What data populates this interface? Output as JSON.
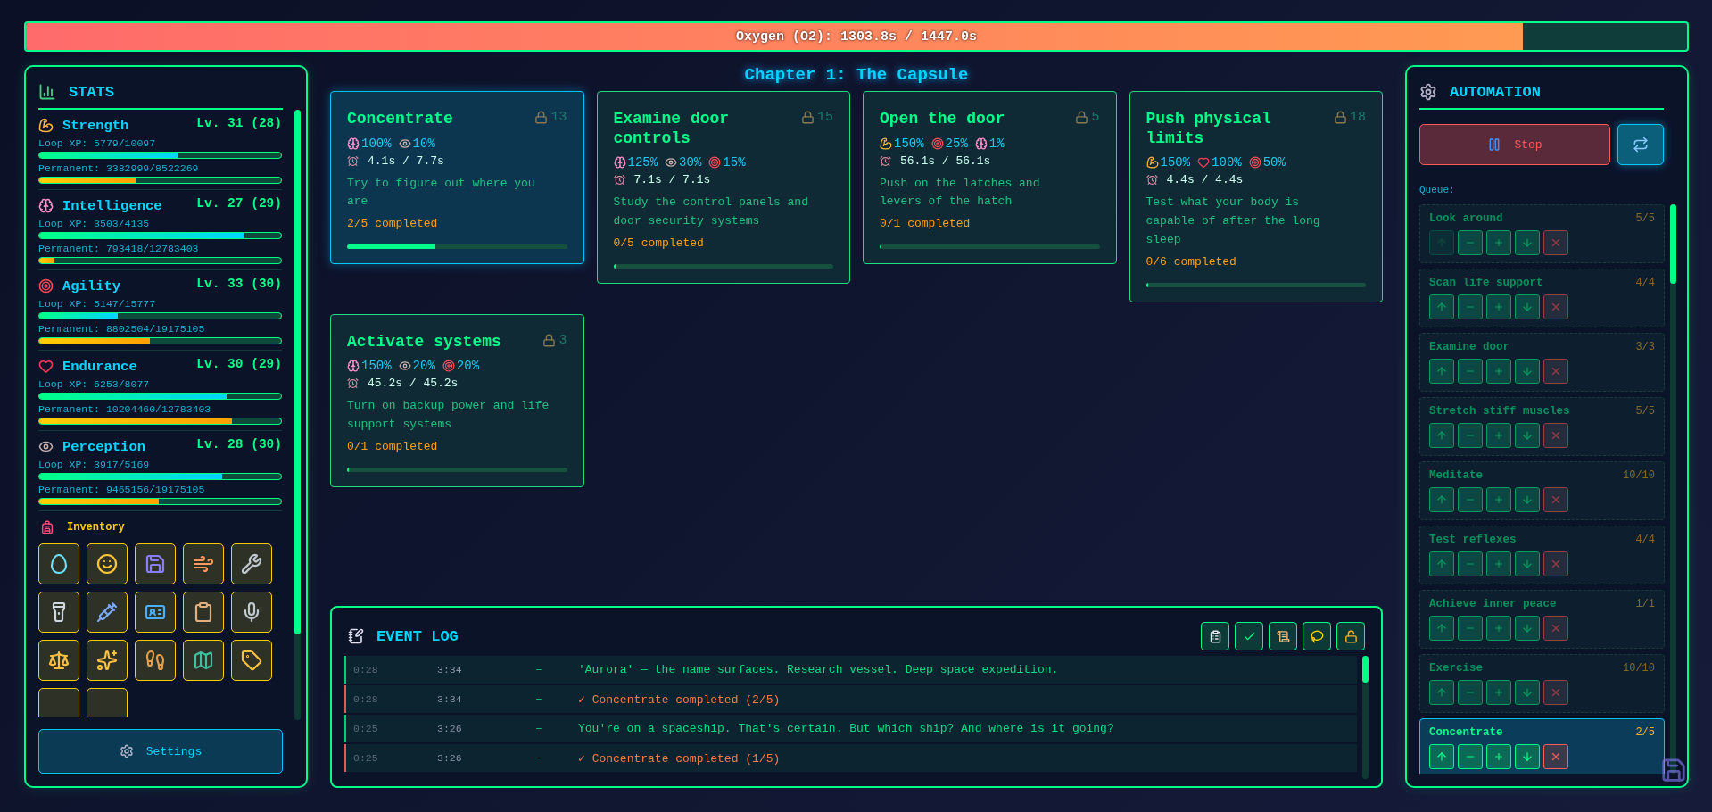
{
  "oxygen": {
    "label": "Oxygen (O2): 1303.8s / 1447.0s",
    "level": 0.901
  },
  "stats": {
    "title": "STATS",
    "items": [
      {
        "kind": "strength",
        "name": "Strength",
        "level_text": "Lv. 31 (28)",
        "loop": {
          "label": "Loop XP: 5779/10097",
          "level": 0.572
        },
        "permanent": {
          "label": "Permanent: 3382999/8522269",
          "level": 0.397
        }
      },
      {
        "kind": "intelligence",
        "name": "Intelligence",
        "level_text": "Lv. 27 (29)",
        "loop": {
          "label": "Loop XP: 3503/4135",
          "level": 0.847
        },
        "permanent": {
          "label": "Permanent: 793418/12783403",
          "level": 0.062
        }
      },
      {
        "kind": "agility",
        "name": "Agility",
        "level_text": "Lv. 33 (30)",
        "loop": {
          "label": "Loop XP: 5147/15777",
          "level": 0.326
        },
        "permanent": {
          "label": "Permanent: 8802504/19175105",
          "level": 0.459
        }
      },
      {
        "kind": "endurance",
        "name": "Endurance",
        "level_text": "Lv. 30 (29)",
        "loop": {
          "label": "Loop XP: 6253/8077",
          "level": 0.774
        },
        "permanent": {
          "label": "Permanent: 10204460/12783403",
          "level": 0.798
        }
      },
      {
        "kind": "perception",
        "name": "Perception",
        "level_text": "Lv. 28 (30)",
        "loop": {
          "label": "Loop XP: 3917/5169",
          "level": 0.758
        },
        "permanent": {
          "label": "Permanent: 9465156/19175105",
          "level": 0.494
        }
      }
    ]
  },
  "inventory": {
    "title": "Inventory",
    "items": [
      {
        "kind": "mirror"
      },
      {
        "kind": "mask"
      },
      {
        "kind": "floppy"
      },
      {
        "kind": "beads"
      },
      {
        "kind": "wrench"
      },
      {
        "kind": "flashlight"
      },
      {
        "kind": "syringe"
      },
      {
        "kind": "id_card"
      },
      {
        "kind": "clipboard"
      },
      {
        "kind": "microphone"
      },
      {
        "kind": "scale"
      },
      {
        "kind": "sparkles"
      },
      {
        "kind": "boot"
      },
      {
        "kind": "map"
      },
      {
        "kind": "tag"
      },
      {
        "kind": "empty"
      },
      {
        "kind": "empty"
      }
    ]
  },
  "settings": {
    "label": "Settings"
  },
  "chapter_title": "Chapter 1: The Capsule",
  "actions": [
    {
      "name": "Concentrate",
      "lock_count": "13",
      "selected": true,
      "requirements": [
        {
          "kind": "intelligence",
          "value": "100%"
        },
        {
          "kind": "perception",
          "value": "10%"
        }
      ],
      "time": "4.1s / 7.7s",
      "description": "Try to figure out where you are",
      "completed": "2/5 completed",
      "level": 0.4
    },
    {
      "name": "Examine door controls",
      "lock_count": "15",
      "selected": false,
      "requirements": [
        {
          "kind": "intelligence",
          "value": "125%"
        },
        {
          "kind": "perception",
          "value": "30%"
        },
        {
          "kind": "agility",
          "value": "15%"
        }
      ],
      "time": "7.1s / 7.1s",
      "description": "Study the control panels and door security systems",
      "completed": "0/5 completed",
      "level": 0
    },
    {
      "name": "Open the door",
      "lock_count": "5",
      "selected": false,
      "requirements": [
        {
          "kind": "strength",
          "value": "150%"
        },
        {
          "kind": "agility",
          "value": "25%"
        },
        {
          "kind": "intelligence",
          "value": "1%"
        }
      ],
      "time": "56.1s / 56.1s",
      "description": "Push on the latches and levers of the hatch",
      "completed": "0/1 completed",
      "level": 0
    },
    {
      "name": "Push physical limits",
      "lock_count": "18",
      "selected": false,
      "requirements": [
        {
          "kind": "strength",
          "value": "150%"
        },
        {
          "kind": "endurance",
          "value": "100%"
        },
        {
          "kind": "agility",
          "value": "50%"
        }
      ],
      "time": "4.4s / 4.4s",
      "description": "Test what your body is capable of after the long sleep",
      "completed": "0/6 completed",
      "level": 0
    },
    {
      "name": "Activate systems",
      "lock_count": "3",
      "selected": false,
      "requirements": [
        {
          "kind": "intelligence",
          "value": "150%"
        },
        {
          "kind": "perception",
          "value": "20%"
        },
        {
          "kind": "agility",
          "value": "20%"
        }
      ],
      "time": "45.2s / 45.2s",
      "description": "Turn on backup power and life support systems",
      "completed": "0/1 completed",
      "level": 0
    }
  ],
  "event_log": {
    "title": "EVENT LOG",
    "filters": [
      {
        "kind": "clipboard"
      },
      {
        "kind": "check"
      },
      {
        "kind": "scroll"
      },
      {
        "kind": "lasso"
      },
      {
        "kind": "unlock"
      }
    ],
    "entries": [
      {
        "kind": "story",
        "time": "0:28",
        "game_time": "3:34",
        "separator": "–",
        "message": "'Aurora' — the name surfaces. Research vessel. Deep space expedition."
      },
      {
        "kind": "completion",
        "time": "0:28",
        "game_time": "3:34",
        "separator": "–",
        "message": "✓ Concentrate completed (2/5)"
      },
      {
        "kind": "story",
        "time": "0:25",
        "game_time": "3:26",
        "separator": "–",
        "message": "You're on a spaceship. That's certain. But which ship? And where is it going?"
      },
      {
        "kind": "completion",
        "time": "0:25",
        "game_time": "3:26",
        "separator": "–",
        "message": "✓ Concentrate completed (1/5)"
      }
    ]
  },
  "automation": {
    "title": "AUTOMATION",
    "stop": {
      "label": "Stop"
    },
    "repeat": {
      "on": true
    },
    "queue_label": "Queue:",
    "queue": [
      {
        "name": "Look around",
        "count": "5/5",
        "selected": false,
        "up_disabled": true
      },
      {
        "name": "Scan life support",
        "count": "4/4",
        "selected": false,
        "up_disabled": false
      },
      {
        "name": "Examine door",
        "count": "3/3",
        "selected": false,
        "up_disabled": false
      },
      {
        "name": "Stretch stiff muscles",
        "count": "5/5",
        "selected": false,
        "up_disabled": false
      },
      {
        "name": "Meditate",
        "count": "10/10",
        "selected": false,
        "up_disabled": false
      },
      {
        "name": "Test reflexes",
        "count": "4/4",
        "selected": false,
        "up_disabled": false
      },
      {
        "name": "Achieve inner peace",
        "count": "1/1",
        "selected": false,
        "up_disabled": false
      },
      {
        "name": "Exercise",
        "count": "10/10",
        "selected": false,
        "up_disabled": false
      },
      {
        "name": "Concentrate",
        "count": "2/5",
        "selected": true,
        "up_disabled": false
      }
    ]
  }
}
